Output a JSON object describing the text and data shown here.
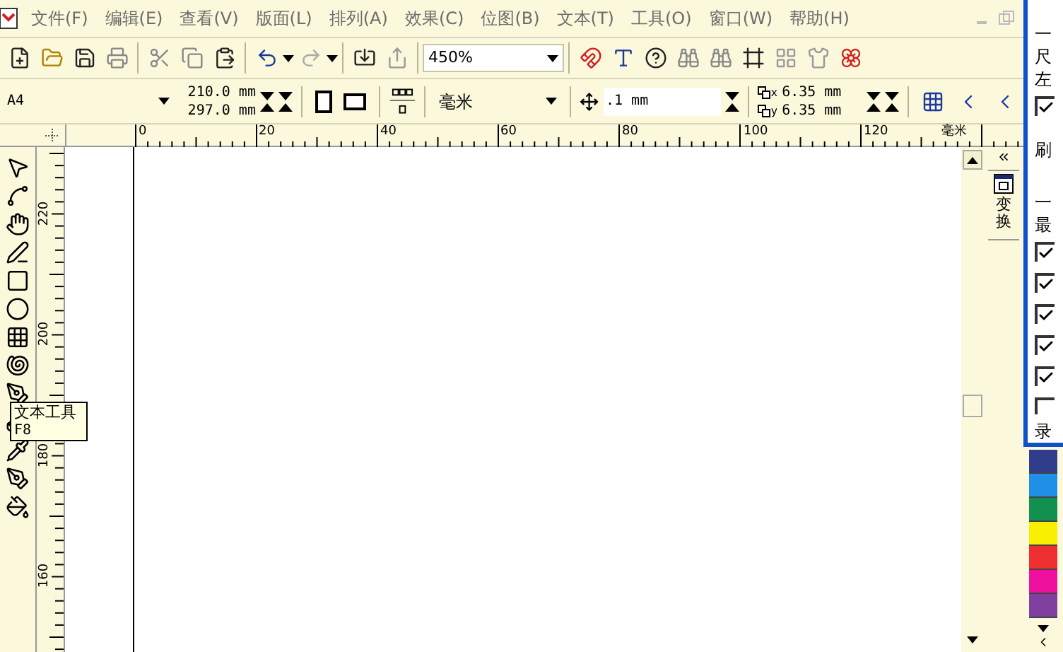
{
  "menu_bar": [
    "文件(F)",
    "编辑(E)",
    "查看(V)",
    "版面(L)",
    "排列(A)",
    "效果(C)",
    "位图(B)",
    "文本(T)",
    "工具(O)",
    "窗口(W)",
    "帮助(H)"
  ],
  "zoom": {
    "value": "450%"
  },
  "property_bar": {
    "paper": "A4",
    "width": "210.0 mm",
    "height": "297.0 mm",
    "units": "毫米",
    "nudge": ".1 mm",
    "dup_x_label": "x",
    "dup_x": "6.35 mm",
    "dup_y_label": "y",
    "dup_y": "6.35 mm"
  },
  "rulers": {
    "horizontal": [
      "0",
      "20",
      "40",
      "60",
      "80",
      "100",
      "120"
    ],
    "unit": "毫米",
    "vertical": [
      "220",
      "200",
      "180",
      "160"
    ]
  },
  "tooltip": {
    "title": "文本工具",
    "shortcut": "F8"
  },
  "docker_tab": "变换",
  "side_dialog": [
    {
      "kind": "text",
      "text": "一"
    },
    {
      "kind": "text",
      "text": "尺"
    },
    {
      "kind": "text",
      "text": "左"
    },
    {
      "kind": "checkbox",
      "checked": true
    },
    {
      "kind": "button",
      "text": "刷"
    },
    {
      "kind": "text",
      "text": "一"
    },
    {
      "kind": "text",
      "text": "最"
    },
    {
      "kind": "checkbox",
      "checked": true
    },
    {
      "kind": "checkbox",
      "checked": true
    },
    {
      "kind": "checkbox",
      "checked": true
    },
    {
      "kind": "checkbox",
      "checked": true
    },
    {
      "kind": "checkbox",
      "checked": true
    },
    {
      "kind": "checkbox",
      "checked": false
    },
    {
      "kind": "text",
      "text": "录"
    }
  ],
  "palette": [
    {
      "color": "#303c8c"
    },
    {
      "color": "#1e90e8"
    },
    {
      "color": "#129050"
    },
    {
      "color": "#f8f000"
    },
    {
      "color": "#f03030"
    },
    {
      "color": "#f010a0"
    },
    {
      "color": "#8040a0"
    }
  ]
}
